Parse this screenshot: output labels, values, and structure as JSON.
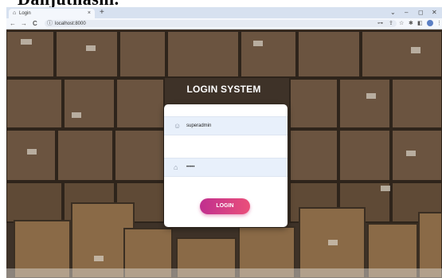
{
  "document_caption": "Danjutnashi.",
  "browser": {
    "tab_title": "Login",
    "tab_close": "×",
    "new_tab": "+",
    "window_controls": {
      "chevron": "⌄",
      "minimize": "–",
      "maximize": "◻",
      "close": "✕"
    },
    "nav": {
      "back": "←",
      "forward": "→",
      "reload": "C"
    },
    "url": "localhost:8000",
    "toolbar_icons": {
      "key": "⊶",
      "share": "⇪",
      "bookmark": "☆",
      "extensions": "✱",
      "sidebar": "◧",
      "menu": "⋮"
    }
  },
  "page": {
    "heading": "LOGIN SYSTEM",
    "username": {
      "value": "superadmin",
      "icon": "user-icon"
    },
    "password": {
      "value": "•••••",
      "icon": "lock-icon"
    },
    "login_button": "LOGIN",
    "colors": {
      "button_start": "#c02f8f",
      "button_end": "#ea4f7a",
      "field_bg": "#e8f0fb"
    }
  }
}
